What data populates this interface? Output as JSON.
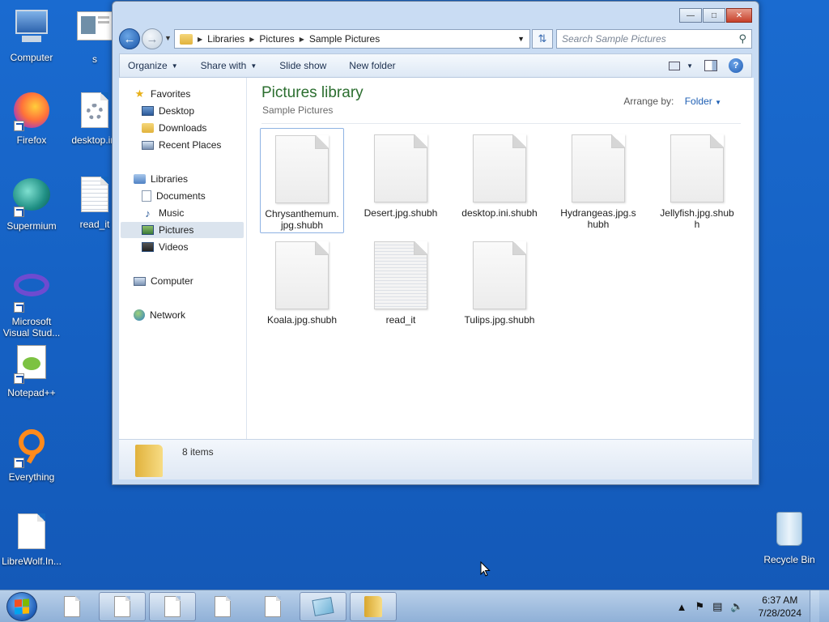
{
  "desktop": {
    "icons": [
      {
        "label": "Computer"
      },
      {
        "label": "s"
      },
      {
        "label": "Firefox"
      },
      {
        "label": "desktop.ini"
      },
      {
        "label": "Supermium"
      },
      {
        "label": "read_it"
      },
      {
        "label": "Microsoft Visual Stud..."
      },
      {
        "label": "Notepad++"
      },
      {
        "label": "Everything"
      },
      {
        "label": "LibreWolf.In..."
      },
      {
        "label": "Recycle Bin"
      }
    ]
  },
  "window": {
    "address": {
      "crumbs": [
        "Libraries",
        "Pictures",
        "Sample Pictures"
      ]
    },
    "search": {
      "placeholder": "Search Sample Pictures"
    },
    "toolbar": {
      "organize": "Organize",
      "share_with": "Share with",
      "slide_show": "Slide show",
      "new_folder": "New folder"
    },
    "nav": {
      "favorites": "Favorites",
      "desktop": "Desktop",
      "downloads": "Downloads",
      "recent_places": "Recent Places",
      "libraries": "Libraries",
      "documents": "Documents",
      "music": "Music",
      "pictures": "Pictures",
      "videos": "Videos",
      "computer": "Computer",
      "network": "Network"
    },
    "content": {
      "title": "Pictures library",
      "subtitle": "Sample Pictures",
      "arrange_label": "Arrange by:",
      "arrange_value": "Folder",
      "items": [
        {
          "label": "Chrysanthemum.jpg.shubh"
        },
        {
          "label": "Desert.jpg.shubh"
        },
        {
          "label": "desktop.ini.shubh"
        },
        {
          "label": "Hydrangeas.jpg.shubh"
        },
        {
          "label": "Jellyfish.jpg.shubh"
        },
        {
          "label": "Koala.jpg.shubh"
        },
        {
          "label": "read_it"
        },
        {
          "label": "Tulips.jpg.shubh"
        }
      ]
    },
    "details": {
      "count": "8 items"
    }
  },
  "taskbar": {
    "time": "6:37 AM",
    "date": "7/28/2024"
  },
  "colors": {
    "desktop_bg": "#1565c0",
    "library_title": "#2b6e2f",
    "link_blue": "#1e5fb4"
  }
}
